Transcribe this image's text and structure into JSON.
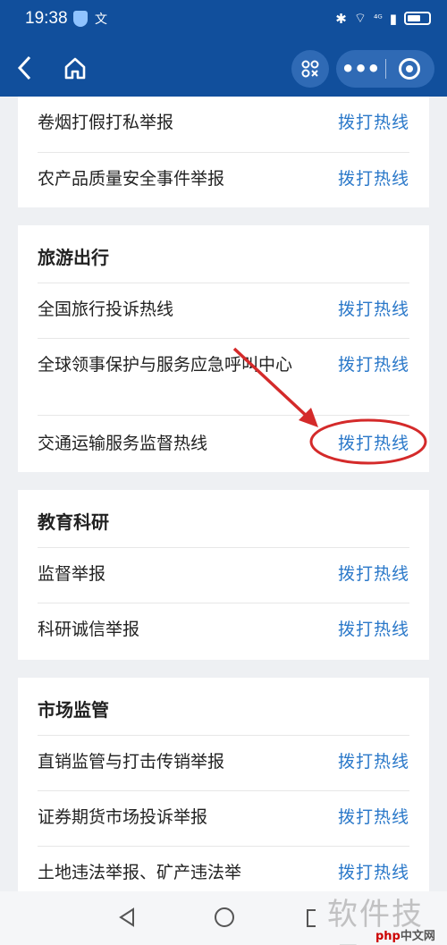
{
  "status": {
    "time": "19:38",
    "left_glyph": "文",
    "right_text": "⁴ᴳ"
  },
  "nav": {
    "back": "back-icon",
    "home": "home-icon",
    "scan_label": "88\nOK",
    "more_label": "•••"
  },
  "action_label": "拨打热线",
  "sections": [
    {
      "title": "",
      "items": [
        "卷烟打假打私举报",
        "农产品质量安全事件举报"
      ]
    },
    {
      "title": "旅游出行",
      "items": [
        "全国旅行投诉热线",
        "全球领事保护与服务应急呼叫中心",
        "交通运输服务监督热线"
      ]
    },
    {
      "title": "教育科研",
      "items": [
        "监督举报",
        "科研诚信举报"
      ]
    },
    {
      "title": "市场监管",
      "items": [
        "直销监管与打击传销举报",
        "证券期货市场投诉举报",
        "土地违法举报、矿产违法举"
      ]
    }
  ],
  "watermark": {
    "main": "软件技巧",
    "small_php": "php",
    "small_rest": "中文网"
  },
  "colors": {
    "brand": "#114f9c",
    "action": "#2a78c9",
    "annotation": "#d42a2a"
  }
}
